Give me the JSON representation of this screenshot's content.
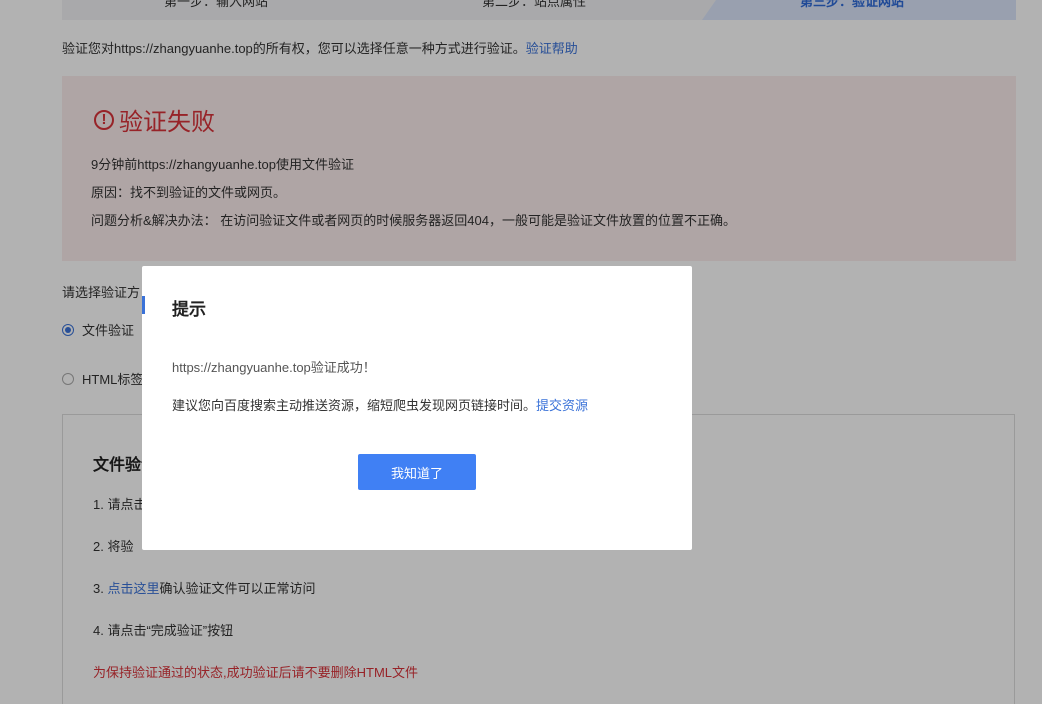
{
  "steps": [
    {
      "label": "第一步：输入网站"
    },
    {
      "label": "第二步：站点属性"
    },
    {
      "label": "第三步：验证网站"
    }
  ],
  "intro": {
    "text": "验证您对https://zhangyuanhe.top的所有权，您可以选择任意一种方式进行验证。",
    "help_link": "验证帮助"
  },
  "failure": {
    "title": "验证失败",
    "line1": "9分钟前https://zhangyuanhe.top使用文件验证",
    "line2": "原因：找不到验证的文件或网页。",
    "line3": "问题分析&解决办法：  在访问验证文件或者网页的时候服务器返回404，一般可能是验证文件放置的位置不正确。"
  },
  "method": {
    "label": "请选择验证方",
    "options": [
      {
        "label": "文件验证",
        "selected": true
      },
      {
        "label": "HTML标签",
        "selected": false
      }
    ]
  },
  "instructions": {
    "title": "文件验证",
    "step1": "1.  请点击",
    "step2": "2.  将验",
    "step3_num": "3.  ",
    "step3_link": "点击这里",
    "step3_text": "确认验证文件可以正常访问",
    "step4": "4.  请点击“完成验证”按钮",
    "warning": "为保持验证通过的状态,成功验证后请不要删除HTML文件"
  },
  "modal": {
    "title": "提示",
    "message1": "https://zhangyuanhe.top验证成功！",
    "message2": "建议您向百度搜索主动推送资源，缩短爬虫发现网页链接时间。",
    "message2_link": "提交资源",
    "button": "我知道了"
  },
  "colors": {
    "accent": "#4080f4",
    "link": "#3a72d8",
    "error": "#d9333a",
    "error_bg": "#fbecec"
  }
}
